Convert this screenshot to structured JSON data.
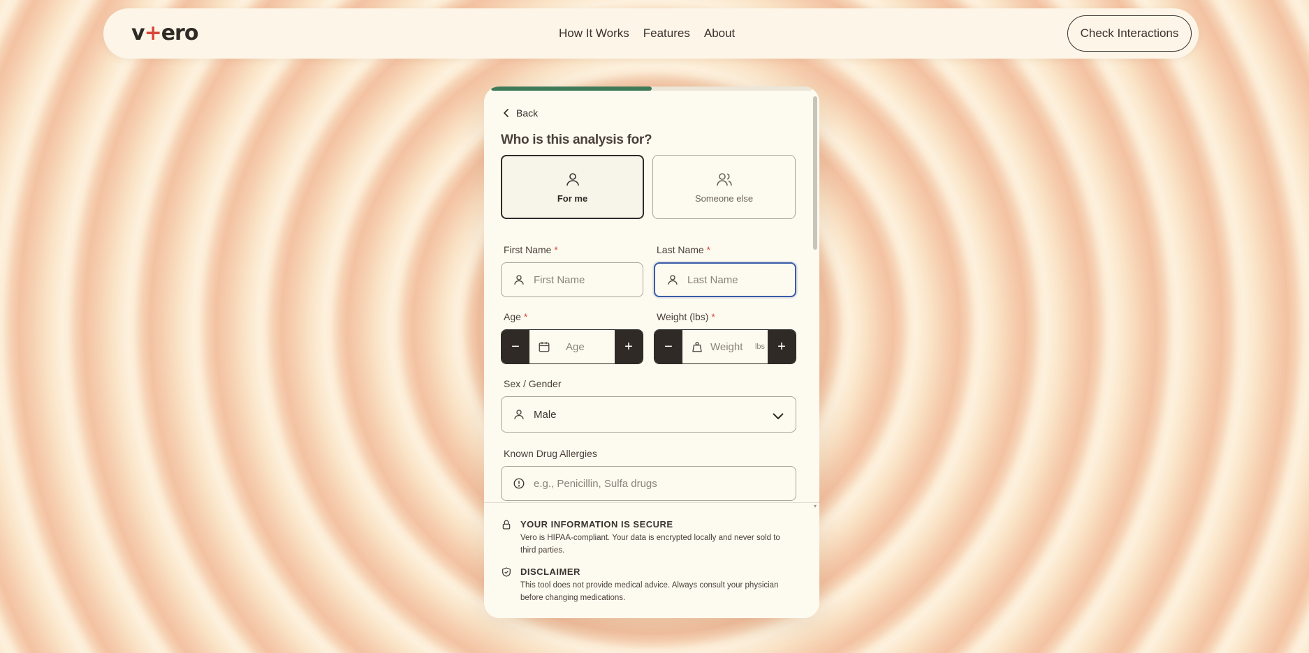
{
  "nav": {
    "logo": "vero",
    "links": [
      "How It Works",
      "Features",
      "About"
    ],
    "cta": "Check Interactions"
  },
  "form": {
    "progress_fraction": 0.5,
    "back_label": "Back",
    "title": "Who is this analysis for?",
    "choices": [
      {
        "label": "For me",
        "icon": "user-icon",
        "selected": true
      },
      {
        "label": "Someone else",
        "icon": "users-icon",
        "selected": false
      }
    ],
    "first_name": {
      "label": "First Name",
      "required": "*",
      "placeholder": "First Name"
    },
    "last_name": {
      "label": "Last Name",
      "required": "*",
      "placeholder": "Last Name"
    },
    "age": {
      "label": "Age",
      "required": "*",
      "placeholder": "Age",
      "minus": "−",
      "plus": "+"
    },
    "weight": {
      "label": "Weight (lbs)",
      "required": "*",
      "placeholder": "Weight",
      "unit": "lbs",
      "minus": "−",
      "plus": "+"
    },
    "sex": {
      "label": "Sex / Gender",
      "value": "Male"
    },
    "allergies": {
      "label": "Known Drug Allergies",
      "placeholder": "e.g., Penicillin, Sulfa drugs"
    }
  },
  "notices": {
    "secure": {
      "title": "YOUR INFORMATION IS SECURE",
      "text": "Vero is HIPAA-compliant. Your data is encrypted locally and never sold to third parties."
    },
    "disclaimer": {
      "title": "DISCLAIMER",
      "text": "This tool does not provide medical advice. Always consult your physician before changing medications."
    }
  },
  "colors": {
    "accent_green": "#3f7a58",
    "required_red": "#d7463a",
    "focus_blue": "#3a5ba8",
    "dark": "#2f2a26"
  }
}
